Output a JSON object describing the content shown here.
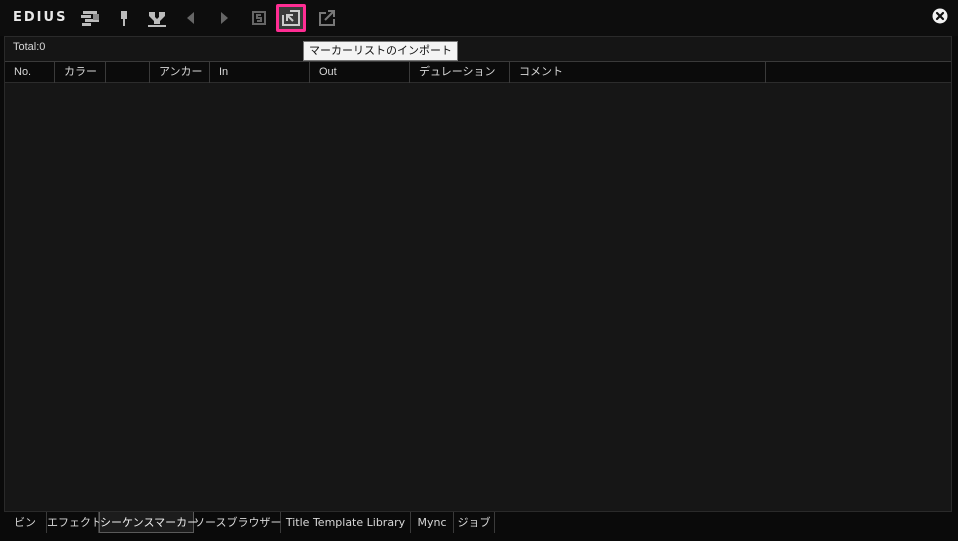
{
  "app": {
    "brand": "EDIUS"
  },
  "toolbar": {
    "tooltip": "マーカーリストのインポート"
  },
  "panel": {
    "total": "Total:0",
    "columns": [
      "No.",
      "カラー",
      "",
      "アンカー",
      "In",
      "Out",
      "デュレーション",
      "コメント",
      ""
    ]
  },
  "tabs": [
    {
      "label": "ビン"
    },
    {
      "label": "エフェクト"
    },
    {
      "label": "シーケンスマーカー"
    },
    {
      "label": "ソースブラウザー"
    },
    {
      "label": "Title Template Library"
    },
    {
      "label": "Mync"
    },
    {
      "label": "ジョブ"
    }
  ],
  "colors": {
    "highlight": "#ff2d93",
    "background": "#151515"
  },
  "icons": [
    "layout-icon",
    "add-marker-icon",
    "clear-marker-icon",
    "prev-marker-icon",
    "next-marker-icon",
    "sync-icon",
    "import-marker-list-icon",
    "export-marker-list-icon",
    "close-icon"
  ]
}
